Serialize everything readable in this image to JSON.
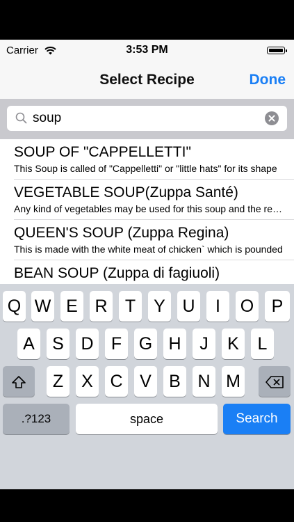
{
  "status_bar": {
    "carrier": "Carrier",
    "time": "3:53 PM"
  },
  "nav": {
    "title": "Select Recipe",
    "done_label": "Done"
  },
  "search": {
    "value": "soup"
  },
  "recipes": [
    {
      "title": "SOUP OF \"CAPPELLETTI\"",
      "subtitle": "This Soup is called of \"Cappelletti\" or \"little hats\" for its shape"
    },
    {
      "title": "VEGETABLE SOUP(Zuppa Santé)",
      "subtitle": "Any kind of vegetables may be used for this soup and the recipe"
    },
    {
      "title": "QUEEN'S SOUP (Zuppa Regina)",
      "subtitle": "This is made with the white meat of chicken` which is pounded"
    },
    {
      "title": "BEAN SOUP (Zuppa di fagiuoli)",
      "subtitle": ""
    }
  ],
  "keyboard": {
    "row1": [
      "Q",
      "W",
      "E",
      "R",
      "T",
      "Y",
      "U",
      "I",
      "O",
      "P"
    ],
    "row2": [
      "A",
      "S",
      "D",
      "F",
      "G",
      "H",
      "J",
      "K",
      "L"
    ],
    "row3": [
      "Z",
      "X",
      "C",
      "V",
      "B",
      "N",
      "M"
    ],
    "numbers_label": ".?123",
    "space_label": "space",
    "search_label": "Search"
  },
  "colors": {
    "accent": "#1a7ff5",
    "keyboard_bg": "#d1d5db",
    "search_bg": "#c9c9ce"
  }
}
